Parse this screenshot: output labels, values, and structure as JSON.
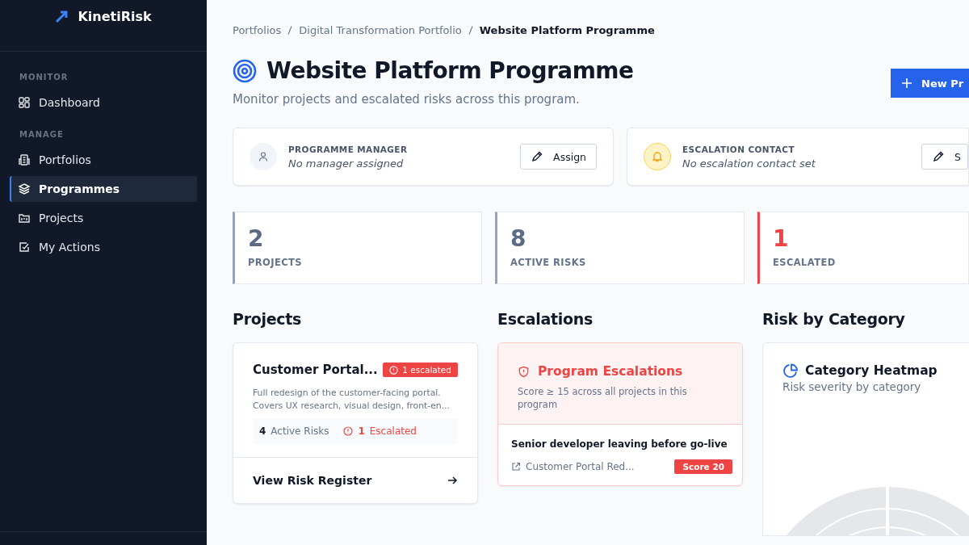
{
  "sidebar": {
    "brand": "KinetiRisk",
    "sections": [
      {
        "title": "MONITOR",
        "items": [
          {
            "label": "Dashboard",
            "selected": false
          }
        ]
      },
      {
        "title": "MANAGE",
        "items": [
          {
            "label": "Portfolios",
            "selected": false
          },
          {
            "label": "Programmes",
            "selected": true
          },
          {
            "label": "Projects",
            "selected": false
          },
          {
            "label": "My Actions",
            "selected": false
          }
        ]
      }
    ]
  },
  "breadcrumb": [
    "Portfolios",
    "Digital Transformation Portfolio",
    "Website Platform Programme"
  ],
  "header": {
    "title": "Website Platform Programme",
    "subtitle": "Monitor projects and escalated risks across this program.",
    "button": "New Pr"
  },
  "contacts": [
    {
      "kind": "manager",
      "label": "PROGRAMME MANAGER",
      "value": "No manager assigned",
      "button": "Assign"
    },
    {
      "kind": "escalation",
      "label": "ESCALATION CONTACT",
      "value": "No escalation contact set",
      "button": "S"
    }
  ],
  "stats": [
    {
      "value": "2",
      "label": "PROJECTS",
      "alert": false
    },
    {
      "value": "8",
      "label": "ACTIVE RISKS",
      "alert": false
    },
    {
      "value": "1",
      "label": "ESCALATED",
      "alert": true
    }
  ],
  "projects": {
    "title": "Projects",
    "cards": [
      {
        "name": "Customer Portal...",
        "badge": "1 escalated",
        "description": "Full redesign of the customer-facing portal. Covers UX research, visual design, front-en...",
        "risks_count": "4",
        "risks_label": "Active Risks",
        "escalated_count": "1",
        "escalated_label": "Escalated",
        "link": "View Risk Register"
      }
    ]
  },
  "escalations": {
    "title": "Escalations",
    "panel_title": "Program Escalations",
    "panel_subtitle": "Score ≥ 15 across all projects in this program",
    "items": [
      {
        "title": "Senior developer leaving before go-live",
        "project": "Customer Portal Red...",
        "score": "Score 20"
      }
    ]
  },
  "category": {
    "title": "Risk by Category",
    "card_title": "Category Heatmap",
    "card_subtitle": "Risk severity by category"
  }
}
